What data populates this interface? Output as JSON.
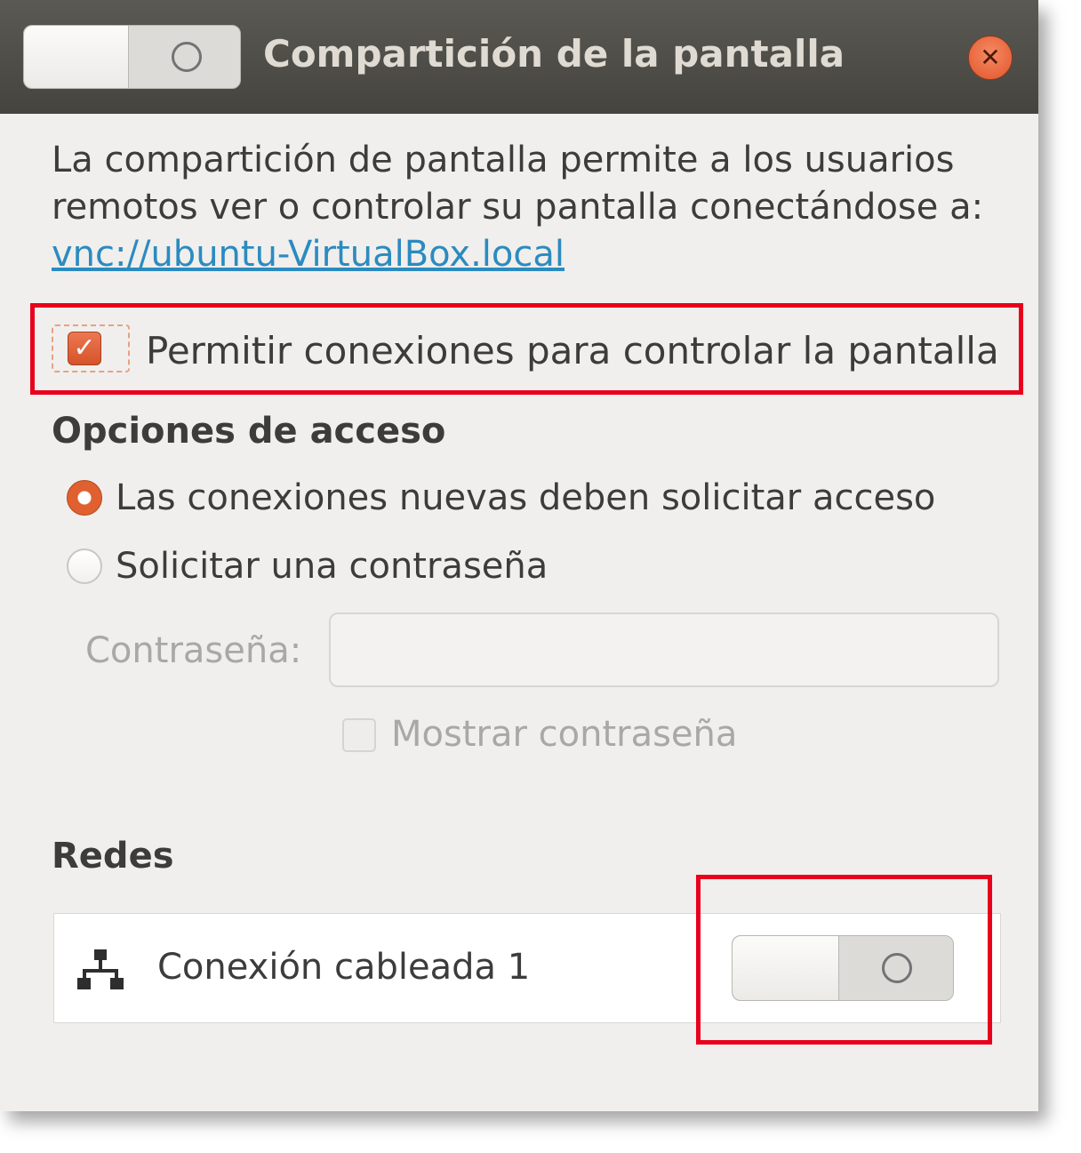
{
  "window": {
    "title": "Compartición de la pantalla",
    "sharing_switch": "off",
    "close_icon": "✕"
  },
  "description": {
    "text": "La compartición de pantalla permite a los usuarios remotos ver o controlar su pantalla conectándose a: ",
    "link": "vnc://ubuntu-VirtualBox.local"
  },
  "allow_control": {
    "label": "Permitir conexiones para controlar la pantalla",
    "checked": true,
    "check_glyph": "✓"
  },
  "access": {
    "heading": "Opciones de acceso",
    "options": [
      {
        "label": "Las conexiones nuevas deben solicitar acceso",
        "selected": true
      },
      {
        "label": "Solicitar una contraseña",
        "selected": false
      }
    ],
    "password_label": "Contraseña:",
    "password_value": "",
    "show_password_label": "Mostrar contraseña",
    "show_password_checked": false
  },
  "networks": {
    "heading": "Redes",
    "items": [
      {
        "icon": "network-wired-icon",
        "label": "Conexión cableada 1",
        "enabled": false
      }
    ]
  },
  "colors": {
    "titlebar": "#4f4e49",
    "accent": "#e0602f",
    "link": "#2b8bc0",
    "highlight": "#e8001c"
  }
}
